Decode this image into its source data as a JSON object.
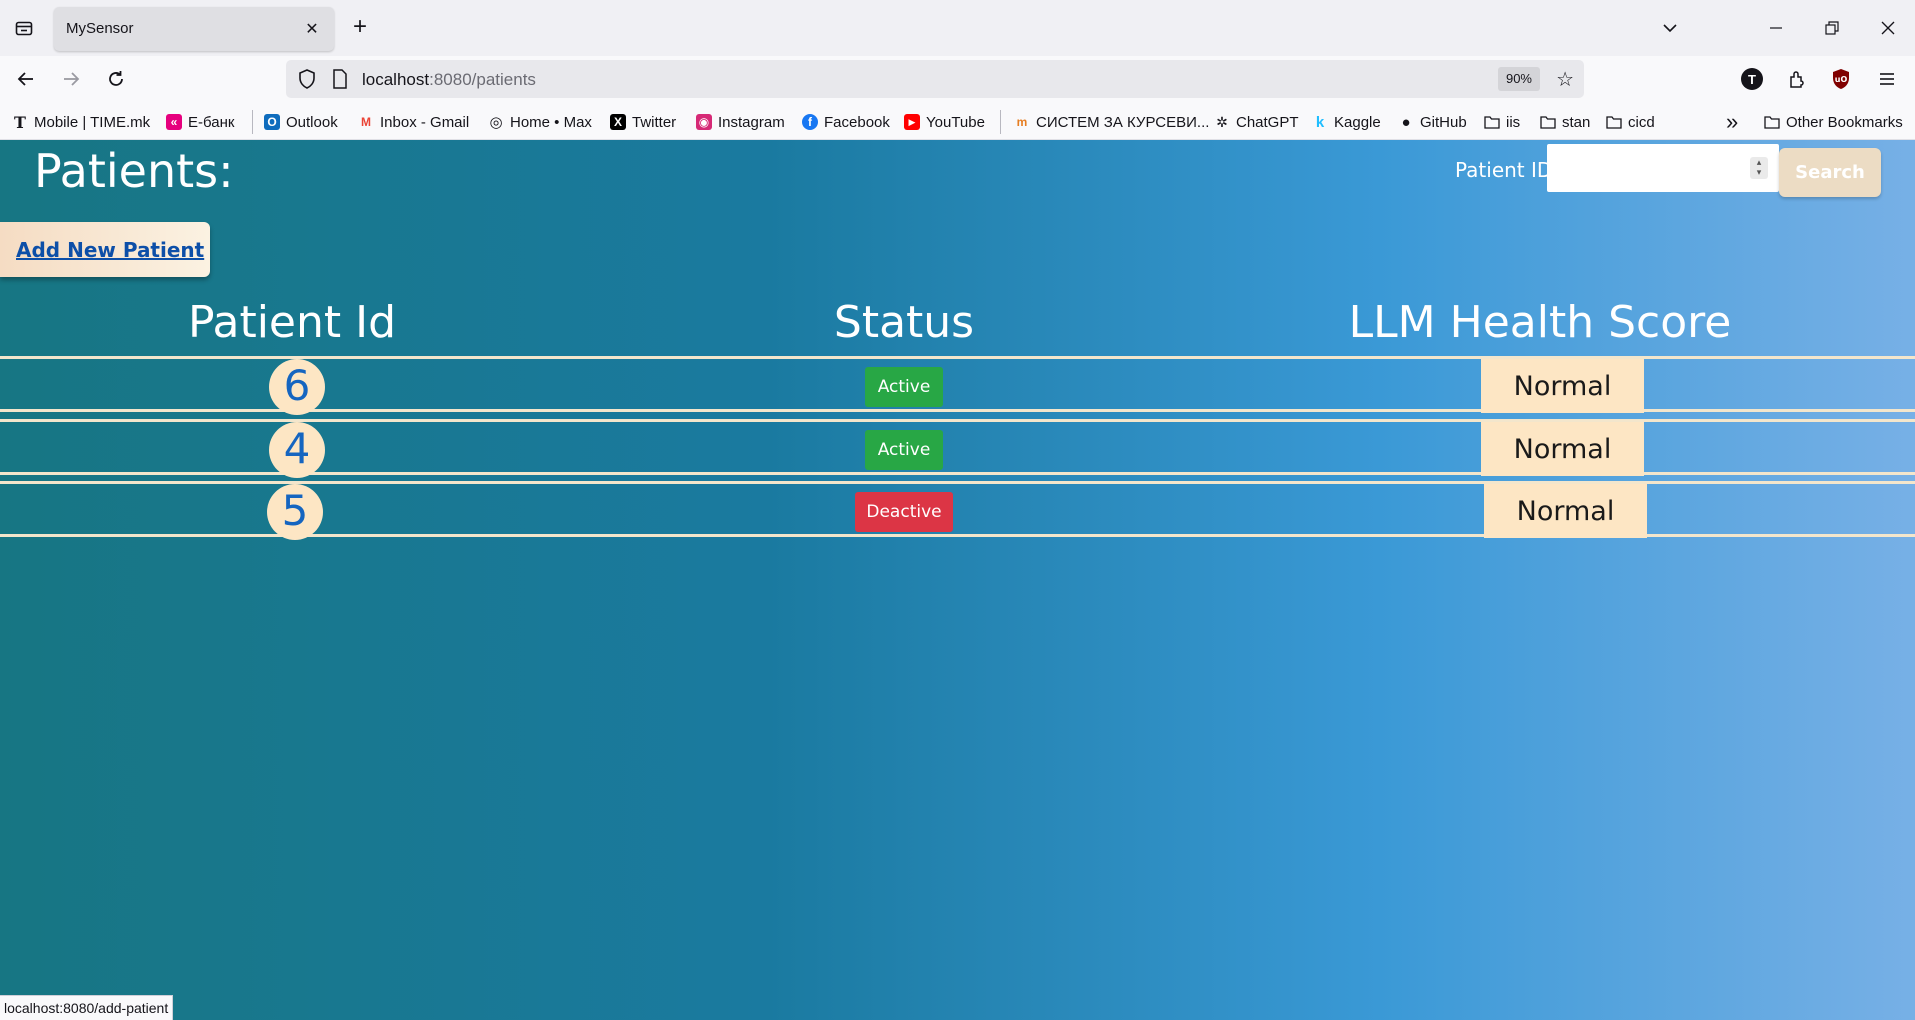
{
  "browser": {
    "tab_title": "MySensor",
    "tab_close": "✕",
    "new_tab": "+",
    "url_host": "localhost",
    "url_path": ":8080/patients",
    "zoom": "90%",
    "profile_initial": "T",
    "status_url": "localhost:8080/add-patient"
  },
  "bookmarks": [
    {
      "label": "Mobile | TIME.mk",
      "icon": "T"
    },
    {
      "label": "Е-банк",
      "icon": "«"
    },
    {
      "label": "Outlook",
      "icon": "O"
    },
    {
      "label": "Inbox - Gmail",
      "icon": "M"
    },
    {
      "label": "Home • Max",
      "icon": "◎"
    },
    {
      "label": "Twitter",
      "icon": "X"
    },
    {
      "label": "Instagram",
      "icon": "◉"
    },
    {
      "label": "Facebook",
      "icon": "f"
    },
    {
      "label": "YouTube",
      "icon": "▶"
    },
    {
      "label": "СИСТЕМ ЗА КУРСЕВИ...",
      "icon": "m"
    },
    {
      "label": "ChatGPT",
      "icon": "✲"
    },
    {
      "label": "Kaggle",
      "icon": "k"
    },
    {
      "label": "GitHub",
      "icon": "●"
    },
    {
      "label": "iis",
      "icon": "folder"
    },
    {
      "label": "stan",
      "icon": "folder"
    },
    {
      "label": "cicd",
      "icon": "folder"
    }
  ],
  "bookmarks_more": "»",
  "other_bookmarks": "Other Bookmarks",
  "page": {
    "title": "Patients:",
    "search_label": "Patient ID:",
    "search_value": "",
    "search_button": "Search",
    "add_button": "Add New Patient",
    "columns": [
      "Patient Id",
      "Status",
      "LLM Health Score"
    ],
    "rows": [
      {
        "id": "6",
        "status": "Active",
        "score": "Normal"
      },
      {
        "id": "4",
        "status": "Active",
        "score": "Normal"
      },
      {
        "id": "5",
        "status": "Deactive",
        "score": "Normal"
      }
    ]
  },
  "colors": {
    "active": "#28a745",
    "deactive": "#dc3545",
    "badge_bg": "#fde6c4",
    "gradient_start": "#177683",
    "gradient_end": "#77b0e6"
  }
}
